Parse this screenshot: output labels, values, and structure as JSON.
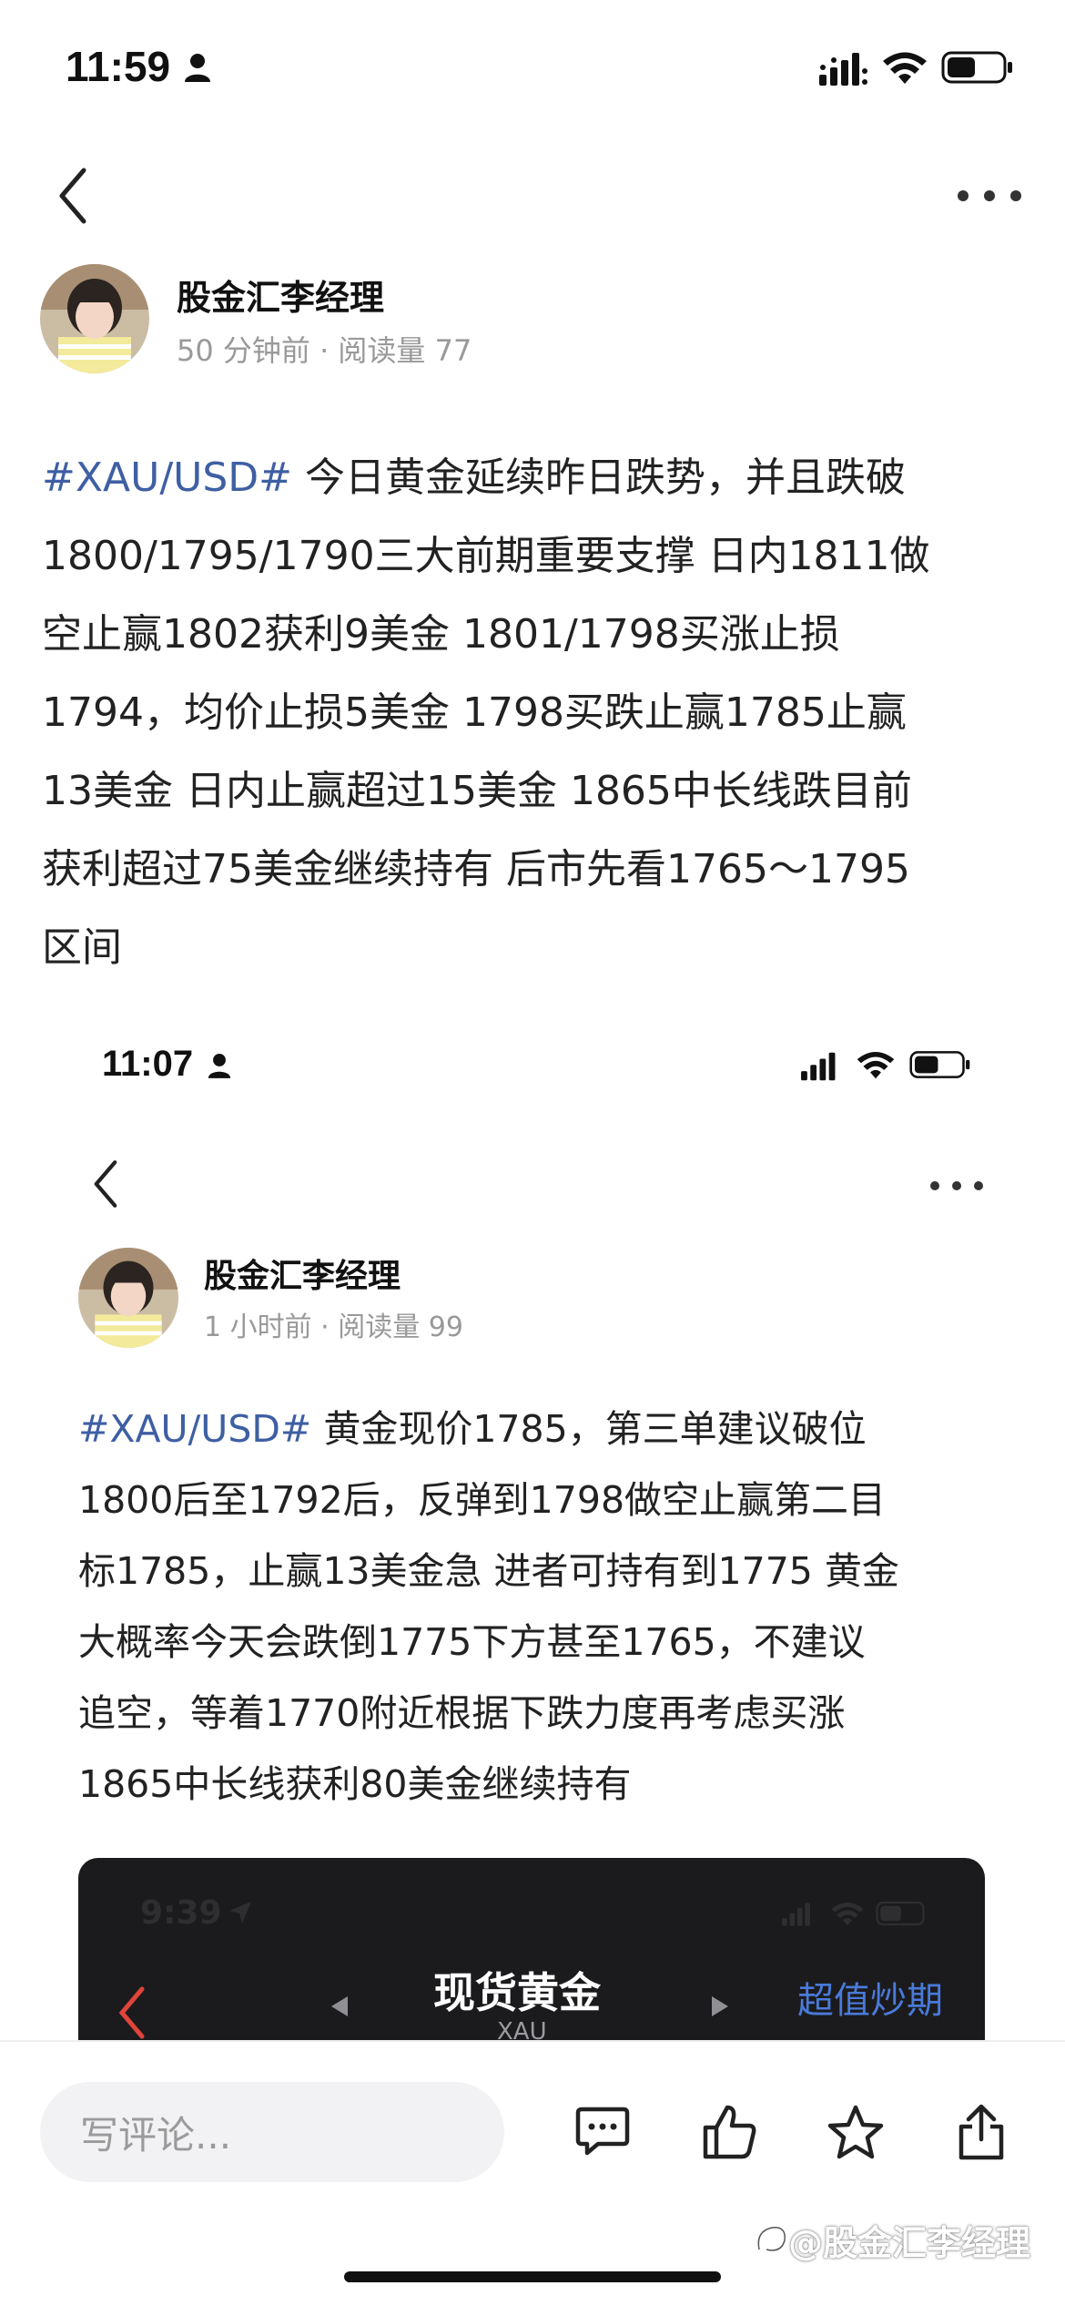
{
  "status_bar": {
    "time": "11:59"
  },
  "nav": {
    "back_icon": "chevron-left-icon",
    "more_icon": "more-dots-icon"
  },
  "post": {
    "author": "股金汇李经理",
    "meta": "50 分钟前 · 阅读量 77",
    "hashtag": "#XAU/USD#",
    "lines": [
      " 今日黄金延续昨日跌势，并且跌破",
      "1800/1795/1790三大前期重要支撑 日内1811做",
      "空止赢1802获利9美金 1801/1798买涨止损",
      "1794，均价止损5美金 1798买跌止赢1785止赢",
      "13美金 日内止赢超过15美金 1865中长线跌目前",
      "获利超过75美金继续持有 后市先看1765～1795",
      "区间"
    ]
  },
  "embedded": {
    "status_time": "11:07",
    "author": "股金汇李经理",
    "meta": "1 小时前 · 阅读量 99",
    "hashtag": "#XAU/USD#",
    "lines": [
      " 黄金现价1785，第三单建议破位",
      "1800后至1792后，反弹到1798做空止赢第二目",
      "标1785，止赢13美金急 进者可持有到1775 黄金",
      "大概率今天会跌倒1775下方甚至1765，不建议",
      "追空，等着1770附近根据下跌力度再考虑买涨",
      "1865中长线获利80美金继续持有"
    ]
  },
  "nested_screenshot": {
    "status_time": "9:39",
    "title": "现货黄金",
    "subtitle": "XAU",
    "right_link": "超值炒期"
  },
  "bottom_bar": {
    "comment_placeholder": "写评论...",
    "icons": [
      "comment-icon",
      "thumbs-up-icon",
      "star-icon",
      "share-icon"
    ]
  },
  "watermark": "@股金汇李经理",
  "colors": {
    "hashtag": "#3e5fa3",
    "meta": "#999999",
    "dark_card": "#1b1b1d",
    "link_blue": "#4a7ad9",
    "back_red": "#e0443a"
  }
}
